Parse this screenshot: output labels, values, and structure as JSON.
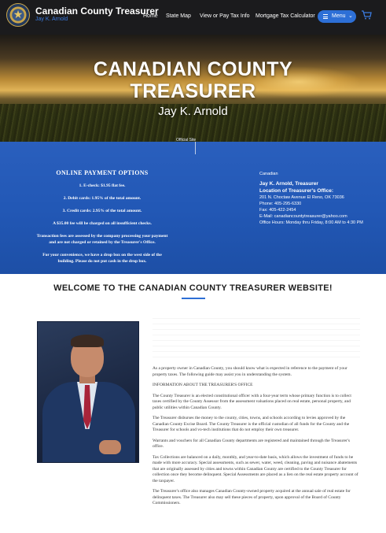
{
  "header": {
    "title": "Canadian County Treasurer",
    "subtitle": "Jay K. Arnold",
    "nav": [
      "Home",
      "State Map",
      "View or Pay Tax Info",
      "Mortgage Tax Calculator"
    ],
    "menu_label": "Menu",
    "menu_icon": "hamburger-icon",
    "cart_icon": "cart-icon",
    "accent": "#2d6fd6"
  },
  "hero": {
    "title_line1": "CANADIAN COUNTY",
    "title_line2": "TREASURER",
    "name": "Jay K. Arnold"
  },
  "band": {
    "tag": "Official Site",
    "payment": {
      "title": "ONLINE PAYMENT OPTIONS",
      "lines": [
        "1. E-check: $1.95 flat fee.",
        "2. Debit cards: 1.95% of the total amount.",
        "3. Credit cards: 2.95% of the total amount."
      ],
      "fee_note": "A $35.00 fee will be charged on all insufficient checks.",
      "processing_note": "Transaction fees are assessed by the company processing your payment and are not charged or retained by the Treasurer's Office.",
      "dropbox_note": "For your convenience, we have a drop box on the west side of the building. Please do not put cash in the drop box."
    },
    "address": {
      "county": "Canadian",
      "name": "Jay K. Arnold, Treasurer",
      "location_heading": "Location of Treasurer's Office:",
      "street": "201 N. Choctaw Avenue El Reno, OK 73036",
      "phone": "Phone: 405-295-6330",
      "fax": "Fax: 405-422-2454",
      "email": "E-Mail: canadiancountytreasurer@yahoo.com",
      "hours": "Office Hours: Monday thru Friday, 8:00 AM to 4:30 PM"
    },
    "color": "#2258b6"
  },
  "welcome": {
    "title": "WELCOME TO THE CANADIAN COUNTY TREASURER WEBSITE!"
  },
  "content": {
    "portrait_alt": "Jay K. Arnold portrait",
    "paragraphs": [
      "As a property owner in Canadian County, you should know what is expected in reference to the payment of your property taxes. The following guide may assist you in understanding the system.",
      "INFORMATION ABOUT THE TREASURER'S OFFICE",
      "The County Treasurer is an elected constitutional officer with a four-year term whose primary function is to collect taxes certified by the County Assessor from the assessment valuations placed on real estate, personal property, and public utilities within Canadian County.",
      "The Treasurer disburses the money to the county, cities, towns, and schools according to levies approved by the Canadian County Excise Board. The County Treasurer is the official custodian of all funds for the County and the Treasurer for schools and vo-tech institutions that do not employ their own treasurer.",
      "Warrants and vouchers for all Canadian County departments are registered and maintained through the Treasurer's office.",
      "Tax Collections are balanced on a daily, monthly, and year-to-date basis, which allows the investment of funds to be made with more accuracy. Special assessments, such as sewer, water, weed, cleaning, paving and nuisance abatements that are originally assessed by cities and towns within Canadian County are certified to the County Treasurer for collection once they become delinquent. Special Assessments are placed as a lien on the real estate property account of the taxpayer.",
      "The Treasurer's office also manages Canadian County-owned property acquired at the annual sale of real estate for delinquent taxes. The Treasurer also may sell these pieces of property, upon approval of the Board of County Commissioners."
    ]
  }
}
